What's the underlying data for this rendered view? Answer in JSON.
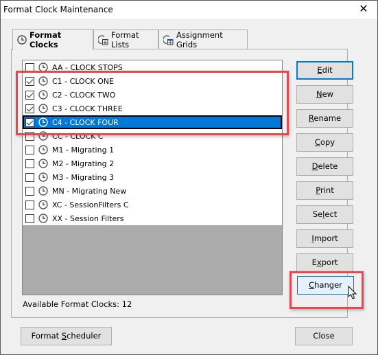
{
  "window": {
    "title": "Format Clock Maintenance",
    "close_glyph": "✕"
  },
  "tabs": [
    {
      "label": "Format Clocks",
      "icon": "clock-icon",
      "active": true
    },
    {
      "label": "Format Lists",
      "icon": "format-list-icon",
      "active": false
    },
    {
      "label": "Assignment Grids",
      "icon": "assignment-grid-icon",
      "active": false
    }
  ],
  "clock_list": {
    "items": [
      {
        "label": "AA - CLOCK STOPS",
        "checked": false,
        "selected": false
      },
      {
        "label": "C1 - CLOCK ONE",
        "checked": true,
        "selected": false
      },
      {
        "label": "C2 - CLOCK TWO",
        "checked": true,
        "selected": false
      },
      {
        "label": "C3 - CLOCK THREE",
        "checked": true,
        "selected": false
      },
      {
        "label": "C4 - CLOCK FOUR",
        "checked": true,
        "selected": true
      },
      {
        "label": "CC - CLOCK C",
        "checked": false,
        "selected": false
      },
      {
        "label": "M1 - Migrating 1",
        "checked": false,
        "selected": false
      },
      {
        "label": "M2 - Migrating 2",
        "checked": false,
        "selected": false
      },
      {
        "label": "M3 - Migrating 3",
        "checked": false,
        "selected": false
      },
      {
        "label": "MN - Migrating New",
        "checked": false,
        "selected": false
      },
      {
        "label": "XC - SessionFilters C",
        "checked": false,
        "selected": false
      },
      {
        "label": "XX - Session Filters",
        "checked": false,
        "selected": false
      }
    ]
  },
  "status": {
    "available_label": "Available Format Clocks: 12"
  },
  "side_buttons": [
    {
      "pre": "",
      "mnemonic": "E",
      "post": "dit",
      "state": "default"
    },
    {
      "pre": "",
      "mnemonic": "N",
      "post": "ew",
      "state": "normal"
    },
    {
      "pre": "",
      "mnemonic": "R",
      "post": "ename",
      "state": "normal"
    },
    {
      "pre": "",
      "mnemonic": "C",
      "post": "opy",
      "state": "normal"
    },
    {
      "pre": "",
      "mnemonic": "D",
      "post": "elete",
      "state": "normal"
    },
    {
      "pre": "",
      "mnemonic": "P",
      "post": "rint",
      "state": "normal"
    },
    {
      "pre": "Se",
      "mnemonic": "l",
      "post": "ect",
      "state": "normal"
    },
    {
      "pre": "",
      "mnemonic": "I",
      "post": "mport",
      "state": "normal"
    },
    {
      "pre": "E",
      "mnemonic": "x",
      "post": "port",
      "state": "normal"
    },
    {
      "pre": "",
      "mnemonic": "C",
      "post": "hanger",
      "state": "hover"
    }
  ],
  "bottom_buttons": {
    "scheduler": {
      "pre": "Format ",
      "mnemonic": "S",
      "post": "cheduler"
    },
    "close": {
      "label": "Close"
    }
  },
  "colors": {
    "selection": "#0078d7",
    "highlight_annotation": "#e8484d",
    "list_empty_area": "#ababab"
  }
}
